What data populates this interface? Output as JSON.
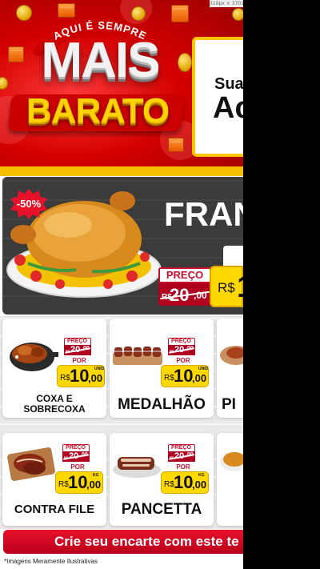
{
  "viewport_size_label": "319px × 3701px",
  "hero": {
    "arc_text": "AQUI É SEMPRE",
    "logo_line1": "MAIS",
    "logo_line2": "BARATO",
    "side_box_line1": "Sua",
    "side_box_line2": "Ac"
  },
  "featured": {
    "discount": "-50%",
    "title": "FRAN",
    "preco_label": "PREÇO",
    "old_price": {
      "currency": "R$",
      "integer": "20",
      "decimal": ",00"
    },
    "new_price": {
      "currency": "R$",
      "integer": "1"
    }
  },
  "products": [
    {
      "name_lines": [
        "COXA E",
        "SOBRECOXA"
      ],
      "preco_label": "PREÇO",
      "old_currency": "R$",
      "old_integer": "20",
      "old_decimal": ",00",
      "por_label": "POR",
      "new_currency": "R$",
      "new_integer": "10",
      "new_decimal": ",00",
      "unit": "UNID"
    },
    {
      "name_lines": [
        "MEDALHÃO"
      ],
      "preco_label": "PREÇO",
      "old_currency": "R$",
      "old_integer": "20",
      "old_decimal": ",00",
      "por_label": "POR",
      "new_currency": "R$",
      "new_integer": "10",
      "new_decimal": ",00",
      "unit": "UNID"
    },
    {
      "name_lines": [
        "PI"
      ]
    },
    {
      "name_lines": [
        "CONTRA FILE"
      ],
      "preco_label": "PREÇO",
      "old_currency": "R$",
      "old_integer": "20",
      "old_decimal": ",00",
      "por_label": "POR",
      "new_currency": "R$",
      "new_integer": "10",
      "new_decimal": ",00",
      "unit": "KG"
    },
    {
      "name_lines": [
        "PANCETTA"
      ],
      "preco_label": "PREÇO",
      "old_currency": "R$",
      "old_integer": "20",
      "old_decimal": ",00",
      "por_label": "POR",
      "new_currency": "R$",
      "new_integer": "10",
      "new_decimal": ",00",
      "unit": "KG"
    }
  ],
  "cta": {
    "label": "Crie seu encarte com este te"
  },
  "disclaimer": "*Imagens Meramente Ilustrativas",
  "colors": {
    "brand_red": "#d40000",
    "accent_yellow": "#ffd800",
    "price_red": "#c8102e",
    "featured_bg": "#3b3b3b"
  }
}
